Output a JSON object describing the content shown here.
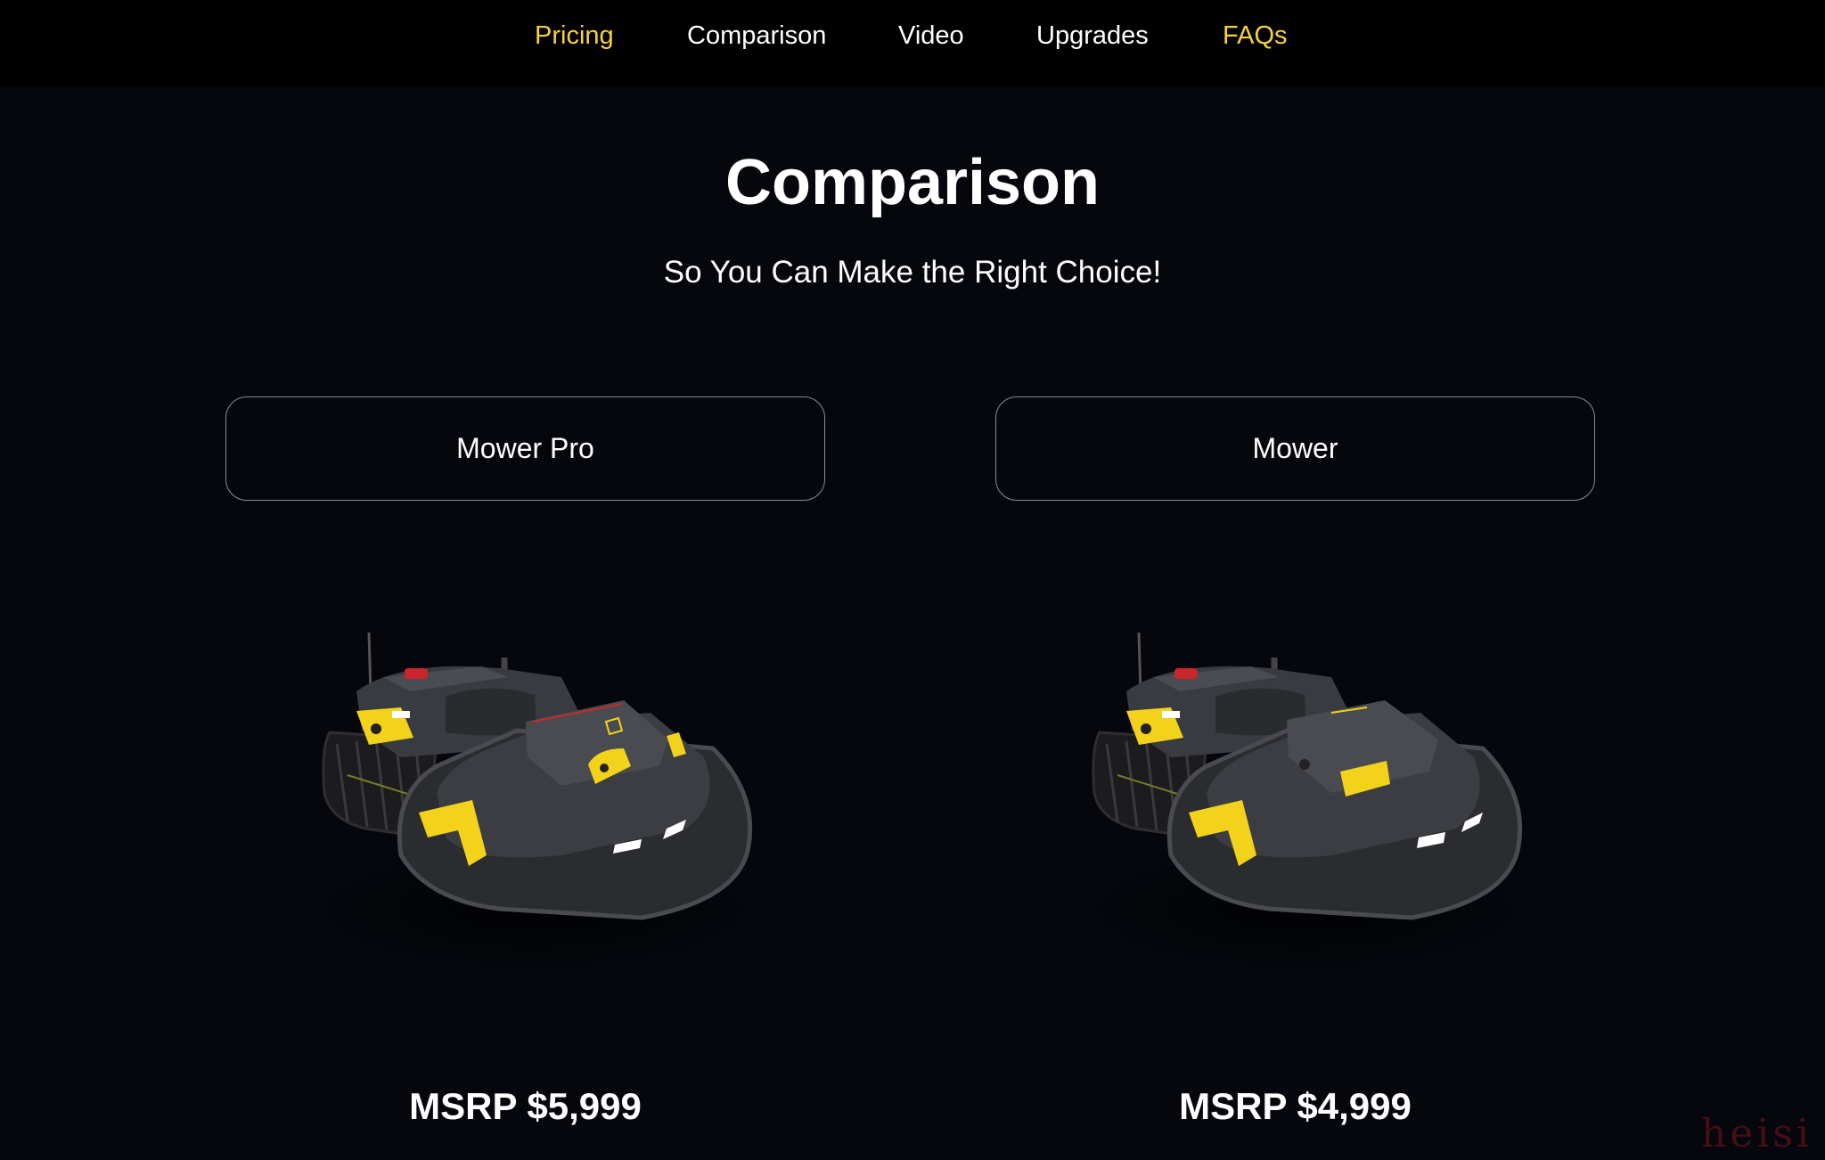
{
  "nav": {
    "items": [
      {
        "label": "Pricing",
        "accent": true
      },
      {
        "label": "Comparison",
        "accent": false
      },
      {
        "label": "Video",
        "accent": false
      },
      {
        "label": "Upgrades",
        "accent": false
      },
      {
        "label": "FAQs",
        "accent": true
      }
    ]
  },
  "header": {
    "title": "Comparison",
    "subtitle": "So You Can Make the Right Choice!"
  },
  "products": [
    {
      "name": "Mower Pro",
      "price": "MSRP $5,999",
      "image": "mower-pro-image"
    },
    {
      "name": "Mower",
      "price": "MSRP $4,999",
      "image": "mower-image"
    }
  ],
  "watermark": "heisi",
  "colors": {
    "background": "#05070d",
    "nav_background": "#000000",
    "accent": "#f5d142",
    "text": "#ffffff",
    "button_border": "#8a8d93",
    "product_yellow": "#f2d21b"
  }
}
